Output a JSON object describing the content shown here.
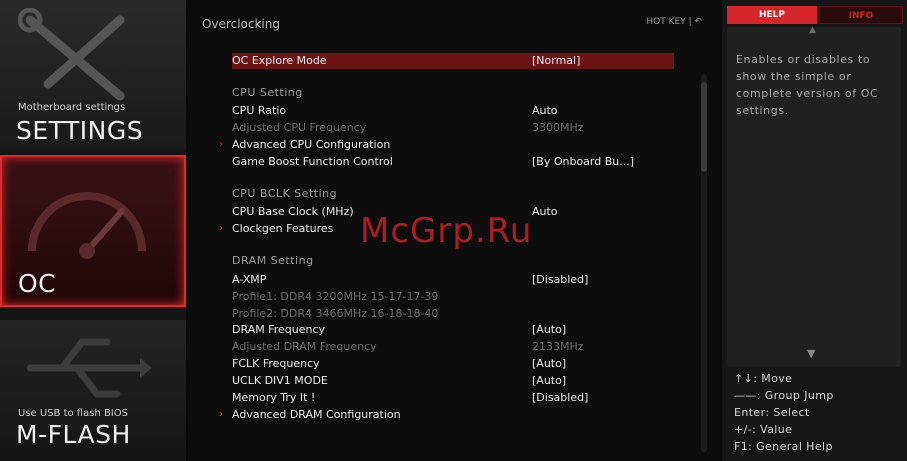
{
  "sidebar": {
    "settings": {
      "sublabel": "Motherboard settings",
      "title": "SETTINGS",
      "icon": "wrench-icon"
    },
    "oc": {
      "title": "OC",
      "icon": "gauge-icon"
    },
    "mflash": {
      "sublabel": "Use USB to flash BIOS",
      "title": "M-FLASH",
      "icon": "usb-icon"
    }
  },
  "main": {
    "header": "Overclocking",
    "hotkey": "HOT KEY  |  ↶",
    "rows": [
      {
        "kind": "item",
        "label": "OC Explore Mode",
        "value": "[Normal]",
        "selected": true
      },
      {
        "kind": "section",
        "label": "CPU  Setting"
      },
      {
        "kind": "item",
        "label": "CPU Ratio",
        "value": "Auto"
      },
      {
        "kind": "disabled",
        "label": "Adjusted CPU Frequency",
        "value": "3300MHz"
      },
      {
        "kind": "submenu",
        "label": "Advanced CPU Configuration"
      },
      {
        "kind": "item",
        "label": "Game Boost Function Control",
        "value": "[By Onboard Bu...]"
      },
      {
        "kind": "section",
        "label": "CPU  BCLK  Setting"
      },
      {
        "kind": "item",
        "label": "CPU Base Clock (MHz)",
        "value": "Auto"
      },
      {
        "kind": "submenu",
        "label": "Clockgen Features"
      },
      {
        "kind": "section",
        "label": "DRAM  Setting"
      },
      {
        "kind": "item",
        "label": "A-XMP",
        "value": "[Disabled]"
      },
      {
        "kind": "disabled",
        "label": "Profile1: DDR4 3200MHz 15-17-17-39"
      },
      {
        "kind": "disabled",
        "label": "Profile2: DDR4 3466MHz 16-18-18-40"
      },
      {
        "kind": "item",
        "label": "DRAM Frequency",
        "value": "[Auto]"
      },
      {
        "kind": "disabled",
        "label": "Adjusted DRAM Frequency",
        "value": "2133MHz"
      },
      {
        "kind": "item",
        "label": "FCLK Frequency",
        "value": "[Auto]"
      },
      {
        "kind": "item",
        "label": "UCLK DIV1 MODE",
        "value": "[Auto]"
      },
      {
        "kind": "item",
        "label": "Memory Try It !",
        "value": "[Disabled]"
      },
      {
        "kind": "submenu",
        "label": "Advanced DRAM Configuration"
      }
    ]
  },
  "help": {
    "tab_help": "HELP",
    "tab_info": "INFO",
    "text": "Enables or disables to show the simple or complete version of OC settings.",
    "keys": [
      "↑↓: Move",
      "——: Group Jump",
      "Enter: Select",
      "+/-: Value",
      "F1: General Help"
    ]
  },
  "watermark": "McGrp.Ru",
  "colors": {
    "accent": "#e0282d",
    "selected_row": "#6a1416"
  }
}
